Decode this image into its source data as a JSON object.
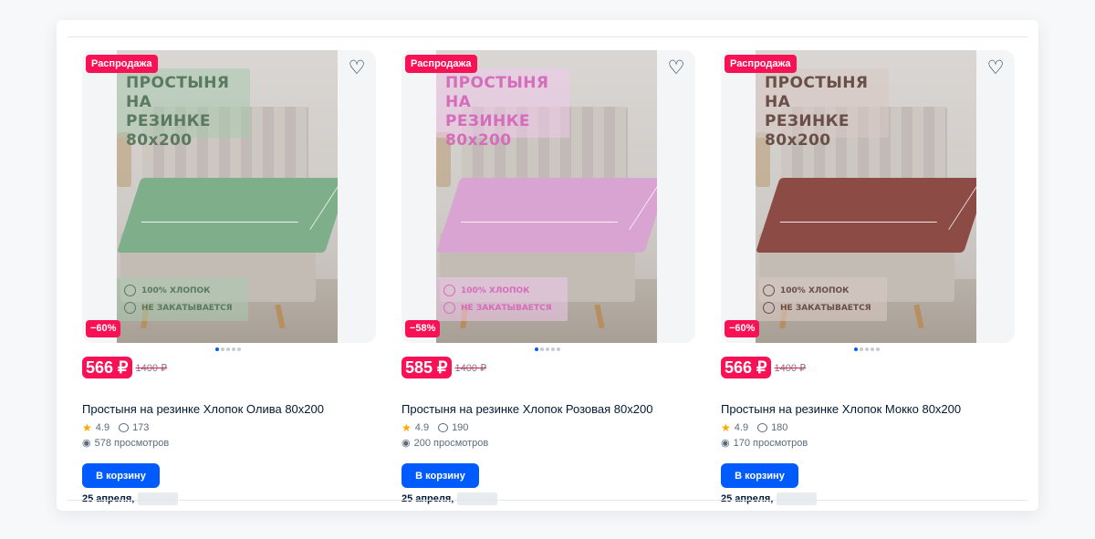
{
  "colors": {
    "accent": "#005bff",
    "sale": "#f91155",
    "star": "#ffa800"
  },
  "products": [
    {
      "sale_label": "Распродажа",
      "discount": "−60%",
      "promo_lines": [
        "ПРОСТЫНЯ",
        "НА РЕЗИНКЕ",
        "80х200"
      ],
      "features": [
        "100% ХЛОПОК",
        "НЕ ЗАКАТЫВАЕТСЯ"
      ],
      "price": "566 ₽",
      "old_price": "1400 ₽",
      "title": "Простыня на резинке Хлопок Олива 80х200",
      "rating": "4.9",
      "reviews": "173",
      "views": "578 просмотров",
      "cart_label": "В корзину",
      "delivery": "25 апреля,",
      "sheet_color": "#7fae8b",
      "promo_color": "#5a7a5f",
      "promo_bg": "rgba(170,200,175,0.55)",
      "image_page": 1,
      "image_count": 5
    },
    {
      "sale_label": "Распродажа",
      "discount": "−58%",
      "promo_lines": [
        "ПРОСТЫНЯ",
        "НА РЕЗИНКЕ",
        "80х200"
      ],
      "features": [
        "100% ХЛОПОК",
        "НЕ ЗАКАТЫВАЕТСЯ"
      ],
      "price": "585 ₽",
      "old_price": "1400 ₽",
      "title": "Простыня на резинке Хлопок Розовая 80х200",
      "rating": "4.9",
      "reviews": "190",
      "views": "200 просмотров",
      "cart_label": "В корзину",
      "delivery": "25 апреля,",
      "sheet_color": "#d9a3d2",
      "promo_color": "#d56cbc",
      "promo_bg": "rgba(240,200,235,0.55)",
      "image_page": 1,
      "image_count": 5
    },
    {
      "sale_label": "Распродажа",
      "discount": "−60%",
      "promo_lines": [
        "ПРОСТЫНЯ",
        "НА РЕЗИНКЕ",
        "80х200"
      ],
      "features": [
        "100% ХЛОПОК",
        "НЕ ЗАКАТЫВАЕТСЯ"
      ],
      "price": "566 ₽",
      "old_price": "1400 ₽",
      "title": "Простыня на резинке Хлопок Мокко 80х200",
      "rating": "4.9",
      "reviews": "180",
      "views": "170 просмотров",
      "cart_label": "В корзину",
      "delivery": "25 апреля,",
      "sheet_color": "#8c4c45",
      "promo_color": "#6a4f49",
      "promo_bg": "rgba(215,200,195,0.6)",
      "image_page": 1,
      "image_count": 5
    }
  ]
}
